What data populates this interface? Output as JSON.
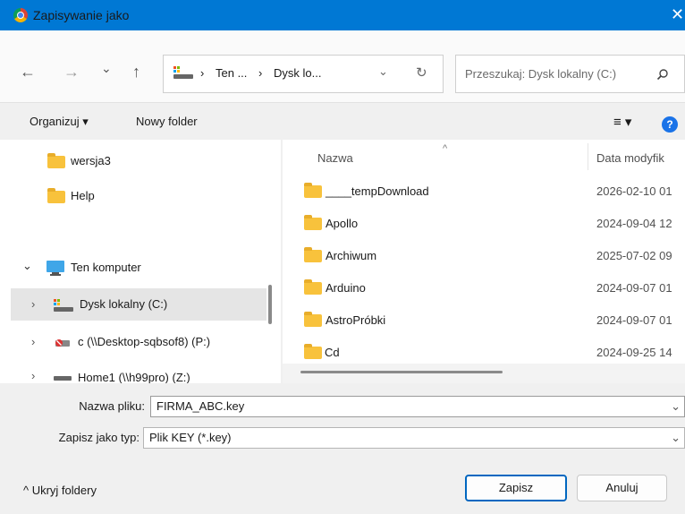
{
  "window": {
    "title": "Zapisywanie jako",
    "close_glyph": "✕"
  },
  "nav": {
    "back_glyph": "←",
    "forward_glyph": "→",
    "recent_glyph": "⌄",
    "up_glyph": "↑",
    "breadcrumb": [
      "Ten ...",
      "Dysk lo..."
    ],
    "breadcrumb_sep": "›",
    "address_dropdown_glyph": "⌄",
    "refresh_glyph": "↻",
    "search_placeholder": "Przeszukaj: Dysk lokalny (C:)"
  },
  "toolbar": {
    "organize_label": "Organizuj ▾",
    "new_folder_label": "Nowy folder",
    "view_glyph": "≡ ▾",
    "help_glyph": "?"
  },
  "sidebar": {
    "items": [
      {
        "label": "wersja3",
        "icon": "folder-icon"
      },
      {
        "label": "Help",
        "icon": "folder-icon"
      },
      {
        "label": "Ten komputer",
        "icon": "computer-icon",
        "expander": "⌄"
      },
      {
        "label": "Dysk lokalny (C:)",
        "icon": "drive-icon",
        "expander": "›",
        "selected": true
      },
      {
        "label": "c (\\\\Desktop-sqbsof8) (P:)",
        "icon": "network-drive-icon",
        "expander": "›"
      },
      {
        "label": "Home1 (\\\\h99pro) (Z:)",
        "icon": "network-drive-icon",
        "expander": "›"
      }
    ]
  },
  "filelist": {
    "columns": {
      "name": "Nazwa",
      "date": "Data modyfik",
      "sort_glyph": "^"
    },
    "rows": [
      {
        "name": "____tempDownload",
        "date": "2026-02-10 01"
      },
      {
        "name": "Apollo",
        "date": "2024-09-04 12"
      },
      {
        "name": "Archiwum",
        "date": "2025-07-02 09"
      },
      {
        "name": "Arduino",
        "date": "2024-09-07 01"
      },
      {
        "name": "AstroPróbki",
        "date": "2024-09-07 01"
      },
      {
        "name": "Cd",
        "date": "2024-09-25 14"
      }
    ]
  },
  "form": {
    "filename_label": "Nazwa pliku:",
    "filename_value": "FIRMA_ABC.key",
    "filetype_label": "Zapisz jako typ:",
    "filetype_value": "Plik KEY (*.key)",
    "chevron": "⌄",
    "hide_folders_label": "^  Ukryj foldery",
    "save_label": "Zapisz",
    "cancel_label": "Anuluj"
  },
  "colors": {
    "titlebar": "#0078d4",
    "accent": "#0067c0",
    "folder": "#f8c23c",
    "selection": "#e5e5e5"
  }
}
